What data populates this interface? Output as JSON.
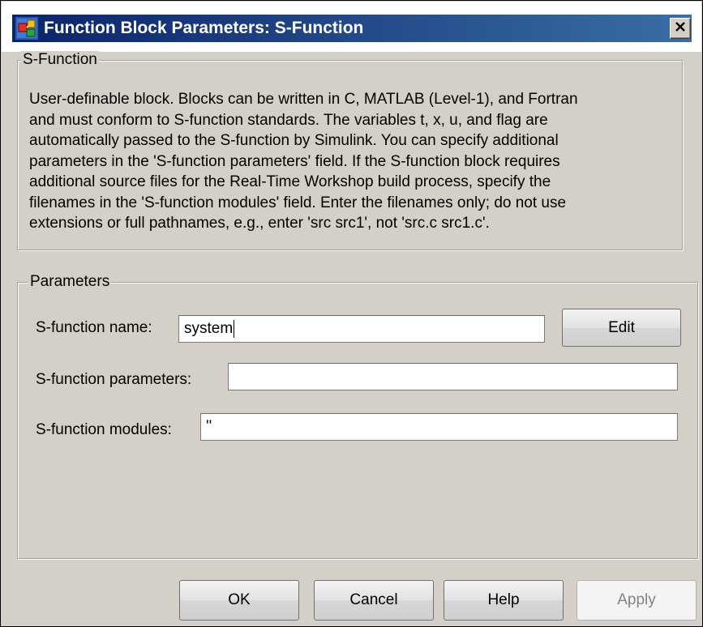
{
  "window": {
    "title": "Function Block Parameters: S-Function",
    "close_glyph": "✕"
  },
  "description_group": {
    "legend": "S-Function",
    "text": "User-definable block.  Blocks can be written in C, MATLAB (Level-1), and Fortran\nand must conform to S-function standards.  The variables t, x, u, and flag are\nautomatically passed to the S-function by Simulink.  You can specify additional\nparameters in the 'S-function parameters' field. If the S-function block requires\nadditional source files for the Real-Time Workshop build process, specify the\nfilenames in the 'S-function modules' field. Enter the filenames only; do not use\nextensions or full pathnames, e.g., enter 'src src1', not 'src.c src1.c'."
  },
  "parameters_group": {
    "legend": "Parameters",
    "name_label": "S-function name:",
    "name_value": "system",
    "edit_button": "Edit",
    "params_label": "S-function parameters:",
    "params_value": "",
    "modules_label": "S-function modules:",
    "modules_value": "''"
  },
  "buttons": {
    "ok": "OK",
    "cancel": "Cancel",
    "help": "Help",
    "apply": "Apply",
    "apply_enabled": false
  },
  "icons": {
    "app": "simulink-block-icon",
    "close": "close-icon"
  }
}
